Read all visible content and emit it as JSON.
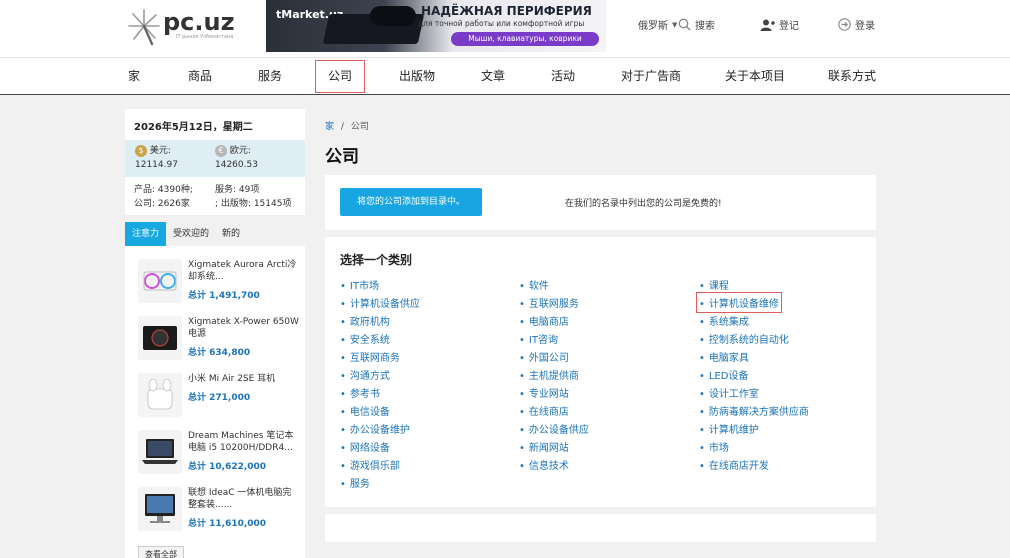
{
  "header": {
    "logo_text": "pc.uz",
    "logo_sub": "IT рынок Узбекистана",
    "banner": {
      "brand": "tMarket.uz",
      "headline": "НАДЁЖНАЯ ПЕРИФЕРИЯ",
      "subline": "для точной работы или комфортной игры",
      "pill": "Мыши, клавиатуры, коврики"
    },
    "language": "俄罗斯",
    "search_label": "搜索",
    "register_label": "登记",
    "login_label": "登录"
  },
  "nav": {
    "items": [
      "家",
      "商品",
      "服务",
      "公司",
      "出版物",
      "文章",
      "活动",
      "对于广告商",
      "关于本项目",
      "联系方式"
    ],
    "active": "公司"
  },
  "sidebar": {
    "date": "2026年5月12日，星期二",
    "usd_label": "美元:",
    "usd_value": "12114.97",
    "eur_label": "欧元:",
    "eur_value": "14260.53",
    "stats": {
      "products_label": "产品:",
      "products_value": "4390种;",
      "services_label": "服务:",
      "services_value": "49项",
      "companies_label": "公司:",
      "companies_value": "2626家",
      "publications_label": "; 出版物:",
      "publications_value": "15145项"
    },
    "tabs": [
      "注意力",
      "受欢迎的",
      "新的"
    ],
    "products": [
      {
        "name": "Xigmatek Aurora Arcti冷却系统...",
        "price": "总计 1,491,700"
      },
      {
        "name": "Xigmatek X-Power 650W 电源",
        "price": "总计 634,800"
      },
      {
        "name": "小米 Mi Air 2SE 耳机",
        "price": "总计 271,000"
      },
      {
        "name": "Dream Machines 笔记本电脑 i5 10200H/DDR4...",
        "price": "总计 10,622,000"
      },
      {
        "name": "联想 IdeaC 一体机电脑完整套装......",
        "price": "总计 11,610,000"
      }
    ],
    "see_all": "查看全部"
  },
  "main": {
    "breadcrumb": {
      "home": "家",
      "sep": "/",
      "current": "公司"
    },
    "title": "公司",
    "add_button": "将您的公司添加到目录中。",
    "free_note": "在我们的名录中列出您的公司是免费的!",
    "category_title": "选择一个类别",
    "col1": [
      "IT市场",
      "计算机设备供应",
      "政府机构",
      "安全系统",
      "互联网商务",
      "沟通方式",
      "参考书",
      "电信设备",
      "办公设备维护",
      "网络设备",
      "游戏俱乐部",
      "服务"
    ],
    "col2": [
      "软件",
      "互联网服务",
      "电脑商店",
      "IT咨询",
      "外国公司",
      "主机提供商",
      "专业网站",
      "在线商店",
      "办公设备供应",
      "新闻网站",
      "信息技术"
    ],
    "col3": [
      "课程",
      "计算机设备维修",
      "系统集成",
      "控制系统的自动化",
      "电脑家具",
      "LED设备",
      "设计工作室",
      "防病毒解决方案供应商",
      "计算机维护",
      "市场",
      "在线商店开发"
    ],
    "highlighted": "计算机设备维修"
  }
}
